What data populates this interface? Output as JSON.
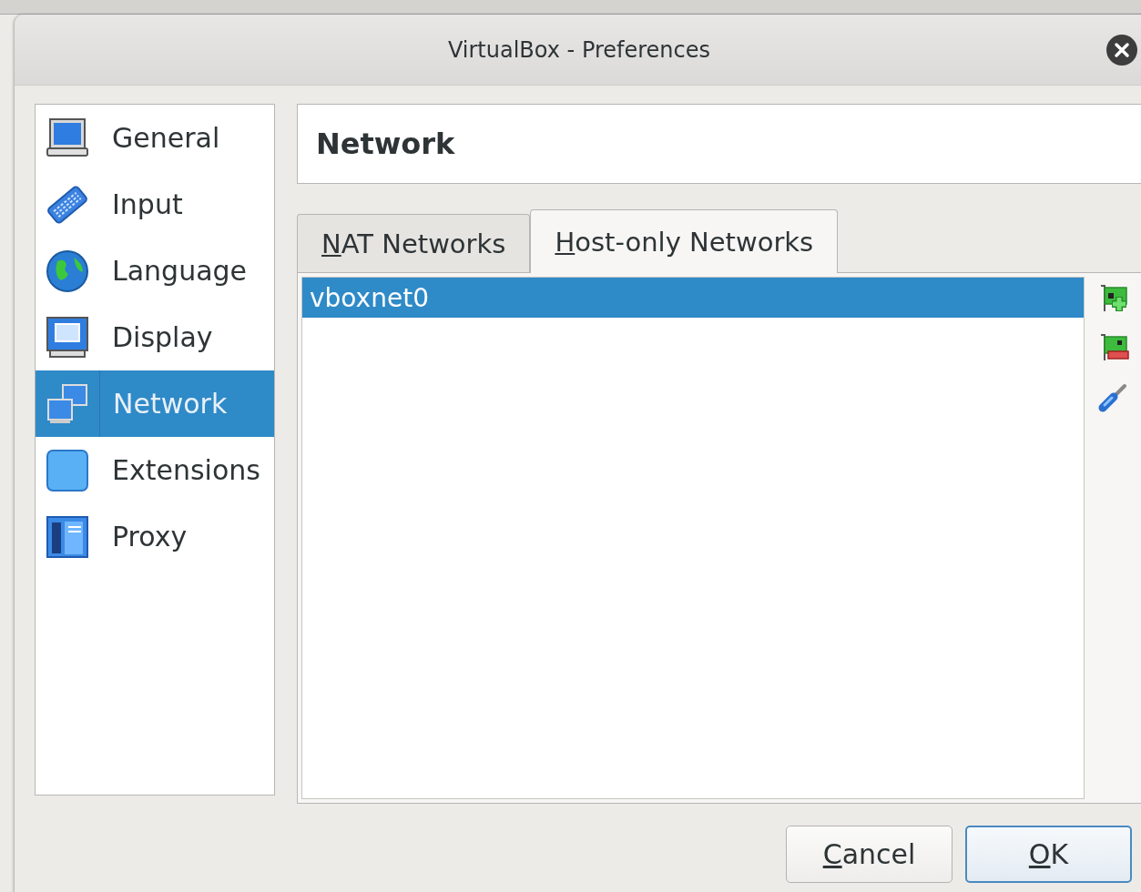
{
  "window": {
    "title": "VirtualBox - Preferences"
  },
  "sidebar": {
    "items": [
      {
        "label": "General",
        "selected": false
      },
      {
        "label": "Input",
        "selected": false
      },
      {
        "label": "Language",
        "selected": false
      },
      {
        "label": "Display",
        "selected": false
      },
      {
        "label": "Network",
        "selected": true
      },
      {
        "label": "Extensions",
        "selected": false
      },
      {
        "label": "Proxy",
        "selected": false
      }
    ]
  },
  "page": {
    "title": "Network"
  },
  "tabs": [
    {
      "label": "NAT Networks",
      "selected": false
    },
    {
      "label": "Host-only Networks",
      "selected": true
    }
  ],
  "networks": [
    {
      "name": "vboxnet0",
      "selected": true
    }
  ],
  "buttons": [
    {
      "label": "Cancel",
      "kind": "normal"
    },
    {
      "label": "OK",
      "kind": "default"
    }
  ]
}
